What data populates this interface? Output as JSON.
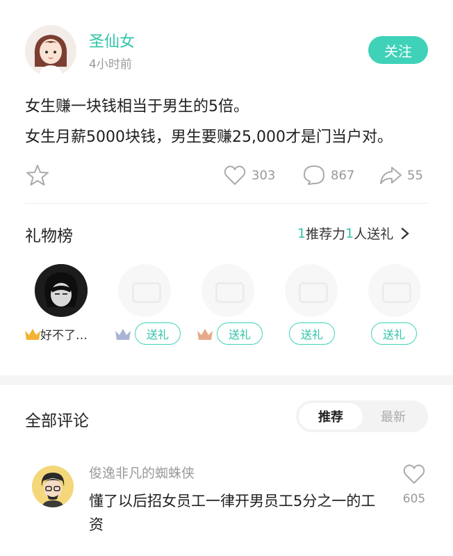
{
  "post": {
    "author": "圣仙女",
    "time": "4小时前",
    "follow_label": "关注",
    "lines": [
      "女生赚一块钱相当于男生的5倍。",
      "女生月薪5000块钱，男生要赚25,000才是门当户对。"
    ],
    "likes": "303",
    "comments": "867",
    "shares": "55"
  },
  "gifts": {
    "title": "礼物榜",
    "summary_num1": "1",
    "summary_text1": "推荐力 ",
    "summary_num2": "1",
    "summary_text2": "人送礼",
    "top_user": "好不了…",
    "send_label": "送礼"
  },
  "comments_section": {
    "title": "全部评论",
    "sort_active": "推荐",
    "sort_inactive": "最新",
    "items": [
      {
        "user": "俊逸非凡的蜘蛛侠",
        "text": "懂了以后招女员工一律开男员工5分之一的工资",
        "likes": "605"
      }
    ]
  },
  "colors": {
    "accent": "#3fd2b8",
    "accent_text": "#2fc3a8",
    "crown_gold": "#f2b233",
    "crown_silver": "#a9b3d6",
    "crown_bronze": "#e8a98a"
  },
  "icons": [
    "star-icon",
    "heart-icon",
    "comment-bubble-icon",
    "share-arrow-icon",
    "chevron-right-icon",
    "crown-icon"
  ]
}
